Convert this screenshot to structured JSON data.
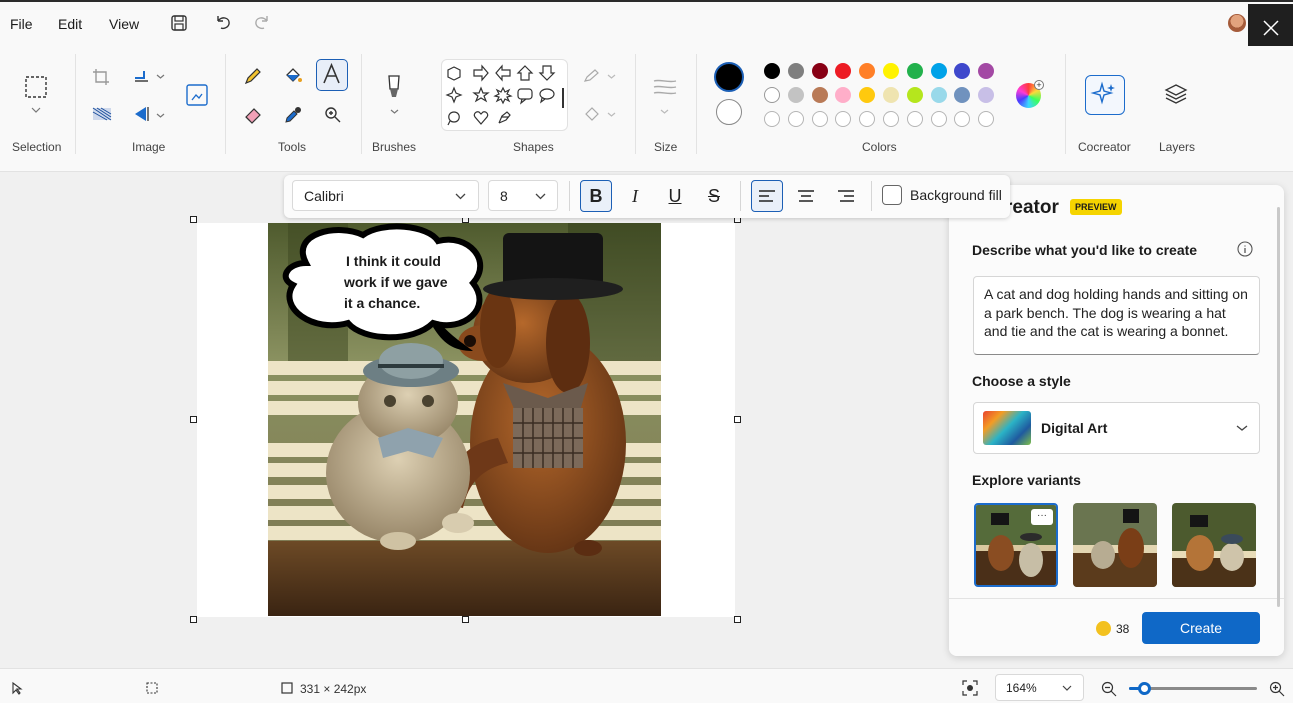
{
  "menu": {
    "file": "File",
    "edit": "Edit",
    "view": "View"
  },
  "ribbon": {
    "groups": {
      "selection": "Selection",
      "image": "Image",
      "tools": "Tools",
      "brushes": "Brushes",
      "shapes": "Shapes",
      "size": "Size",
      "colors": "Colors",
      "cocreator": "Cocreator",
      "layers": "Layers"
    },
    "primary_color": "#000000",
    "secondary_color": "#ffffff",
    "palette_row1": [
      "#000000",
      "#7f7f7f",
      "#880015",
      "#ed1c24",
      "#ff7f27",
      "#fff200",
      "#22b14c",
      "#00a2e8",
      "#3f48cc",
      "#a349a4"
    ],
    "palette_row2": [
      "#ffffff",
      "#c3c3c3",
      "#b97a57",
      "#ffaec9",
      "#ffc90e",
      "#efe4b0",
      "#b5e61d",
      "#99d9ea",
      "#7092be",
      "#c8bfe7"
    ]
  },
  "text_toolbar": {
    "font": "Calibri",
    "size": "8",
    "bold": "B",
    "italic": "I",
    "underline": "U",
    "strike": "S",
    "background_fill": "Background fill"
  },
  "canvas": {
    "speech_line1": "I think it could",
    "speech_line2": "work if we gave",
    "speech_line3": "it a chance."
  },
  "cocreator": {
    "title": "reator",
    "badge": "PREVIEW",
    "describe_label": "Describe what you'd like to create",
    "prompt": "A cat and dog holding hands and sitting on a park bench. The dog is wearing a hat and tie and the cat is wearing a bonnet.",
    "style_label": "Choose a style",
    "style_value": "Digital Art",
    "variants_label": "Explore variants",
    "variant_more": "···",
    "credits": "38",
    "create_button": "Create"
  },
  "status": {
    "selection_size": "331 × 242px",
    "zoom": "164%",
    "zoom_level": 0.12
  },
  "colors": {
    "accent": "#0f68c7",
    "selection_border": "#1c5fb5"
  }
}
